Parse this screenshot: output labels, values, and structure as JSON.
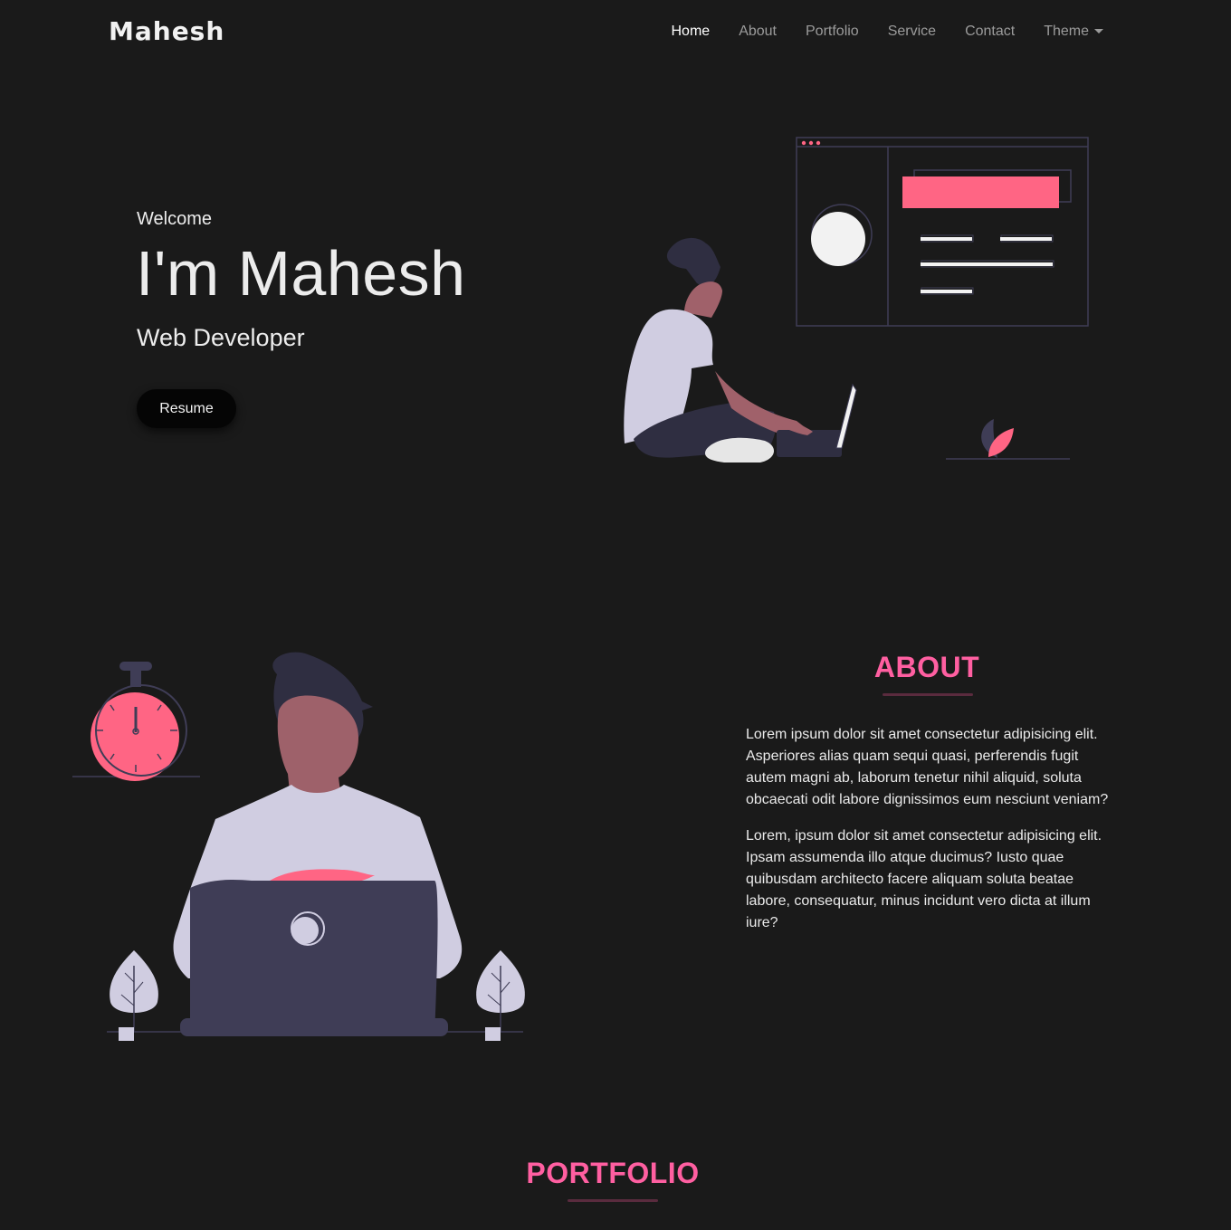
{
  "navbar": {
    "brand": "Mahesh",
    "links": [
      {
        "label": "Home"
      },
      {
        "label": "About"
      },
      {
        "label": "Portfolio"
      },
      {
        "label": "Service"
      },
      {
        "label": "Contact"
      },
      {
        "label": "Theme"
      }
    ],
    "active_link": "Home",
    "theme_dropdown_icon": "chevron-down-icon"
  },
  "hero": {
    "welcome": "Welcome",
    "name": "I'm Mahesh",
    "role": "Web Developer",
    "resume_label": "Resume",
    "illustration": "developer-with-laptop-and-browser-window"
  },
  "about": {
    "title": "ABOUT",
    "paragraphs": [
      "Lorem ipsum dolor sit amet consectetur adipisicing elit. Asperiores alias quam sequi quasi, perferendis fugit autem magni ab, laborum tenetur nihil aliquid, soluta obcaecati odit labore dignissimos eum nesciunt veniam?",
      "Lorem, ipsum dolor sit amet consectetur adipisicing elit. Ipsam assumenda illo atque ducimus? Iusto quae quibusdam architecto facere aliquam soluta beatae labore, consequatur, minus incidunt vero dicta at illum iure?"
    ],
    "illustration": "person-at-laptop-with-stopwatch-and-plants"
  },
  "portfolio": {
    "title": "PORTFOLIO"
  },
  "colors": {
    "background": "#1a1a1a",
    "accent": "#ff5fa1",
    "text": "#eaeaea",
    "nav_inactive": "#9b9b9b",
    "illustration_dark": "#3f3d56",
    "illustration_light": "#d0cde1"
  }
}
